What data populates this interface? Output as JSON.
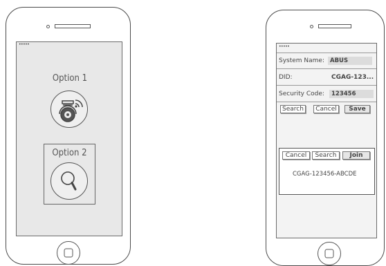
{
  "left_phone": {
    "carrier": "•••••",
    "option1": {
      "label": "Option 1",
      "icon": "camera-wifi-icon"
    },
    "option2": {
      "label": "Option 2",
      "icon": "search-icon"
    }
  },
  "right_phone": {
    "carrier": "•••••",
    "fields": {
      "system_name": {
        "label": "System Name:",
        "value": "ABUS"
      },
      "did": {
        "label": "DID:",
        "value": "CGAG-123..."
      },
      "security_code": {
        "label": "Security Code:",
        "value": "123456"
      }
    },
    "buttons": {
      "search": "Search",
      "cancel": "Cancel",
      "save": "Save"
    },
    "popup": {
      "buttons": {
        "cancel": "Cancel",
        "search": "Search",
        "join": "Join"
      },
      "result": "CGAG-123456-ABCDE"
    }
  }
}
